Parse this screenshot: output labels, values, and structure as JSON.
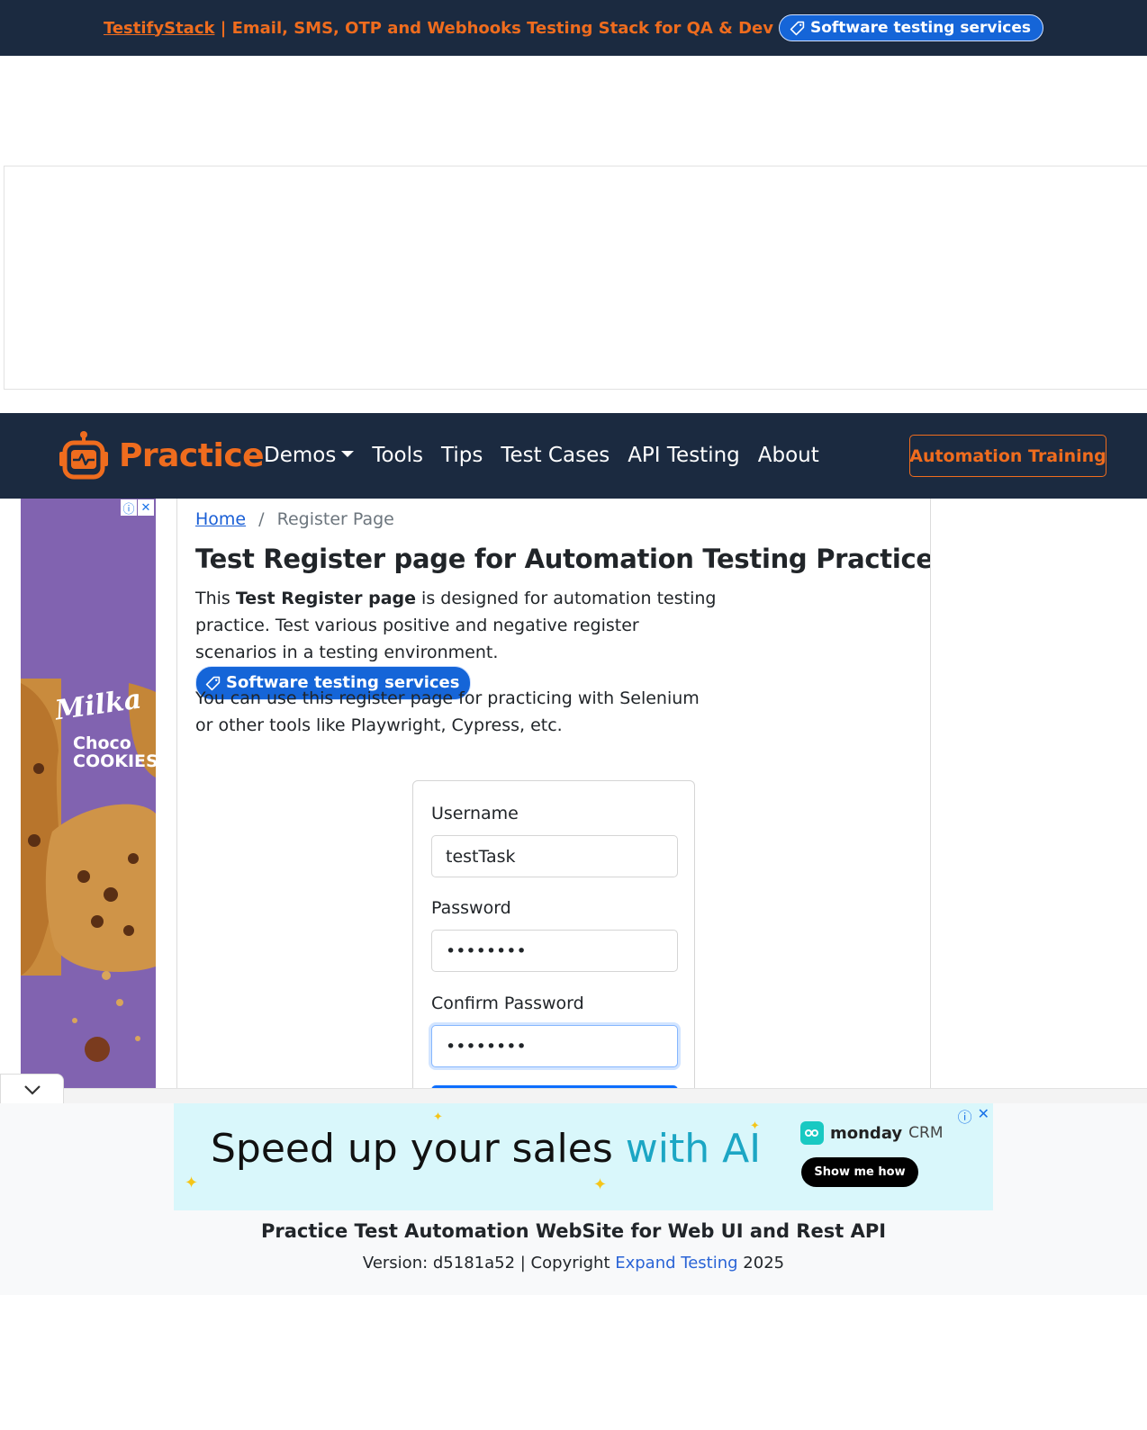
{
  "topbar": {
    "brand": "TestifyStack",
    "text": " | Email, SMS, OTP and Webhooks Testing Stack for QA & Dev",
    "pill_label": "Software testing services"
  },
  "navbar": {
    "brand": "Practice",
    "links": [
      "Demos",
      "Tools",
      "Tips",
      "Test Cases",
      "API Testing",
      "About"
    ],
    "cta": "Automation Training"
  },
  "breadcrumb": {
    "home": "Home",
    "separator": "/",
    "current": "Register Page"
  },
  "page": {
    "title": "Test Register page for Automation Testing Practice",
    "intro_pre": "This ",
    "intro_bold": "Test Register page",
    "intro_post": " is designed for automation testing practice. Test various positive and negative register scenarios in a testing environment.",
    "pill_label": "Software testing services",
    "intro2": "You can use this register page for practicing with Selenium or other tools like Playwright, Cypress, etc."
  },
  "form": {
    "username_label": "Username",
    "username_value": "testTask",
    "password_label": "Password",
    "password_value": "••••••••",
    "confirm_label": "Confirm Password",
    "confirm_value": "••••••••"
  },
  "side_ad": {
    "brand_text": "Milka",
    "product_text": "Choco COOKIES"
  },
  "banner_ad": {
    "headline": "Speed up your sales ",
    "headline_accent": "with AI",
    "brand": "monday",
    "brand_suffix": "CRM",
    "button": "Show me how"
  },
  "footer": {
    "title": "Practice Test Automation WebSite for Web UI and Rest API",
    "version_pre": "Version: d5181a52 | Copyright ",
    "link": "Expand Testing",
    "year": " 2025"
  },
  "colors": {
    "navy": "#1b2a40",
    "orange": "#ef6c1e",
    "primary": "#0d6efd",
    "pill": "#1565d8",
    "ad_purple": "#8163b0",
    "banner_bg": "#d9f7fb"
  },
  "icons": {
    "pill": "tag-icon",
    "brand": "robot-icon",
    "collapse": "chevron-down-icon",
    "ad_info": "info-icon",
    "ad_close": "close-icon"
  }
}
